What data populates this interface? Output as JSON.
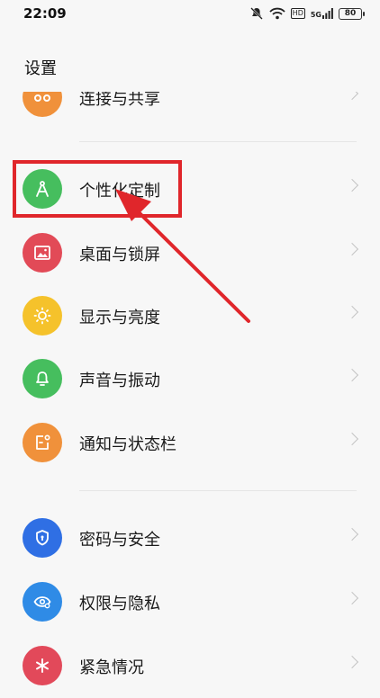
{
  "status_bar": {
    "time": "22:09",
    "hd_label": "HD",
    "network_label": "5G",
    "battery_level": "80"
  },
  "header": {
    "title": "设置"
  },
  "items": [
    {
      "label": "连接与共享",
      "icon": "share-icon",
      "color": "#f0913b"
    },
    {
      "label": "个性化定制",
      "icon": "compass-icon",
      "color": "#46be5e"
    },
    {
      "label": "桌面与锁屏",
      "icon": "image-icon",
      "color": "#e24a57"
    },
    {
      "label": "显示与亮度",
      "icon": "sun-icon",
      "color": "#f5c22b"
    },
    {
      "label": "声音与振动",
      "icon": "bell-icon",
      "color": "#46be5e"
    },
    {
      "label": "通知与状态栏",
      "icon": "notification-icon",
      "color": "#f0913b"
    },
    {
      "label": "密码与安全",
      "icon": "shield-icon",
      "color": "#2f6fe4"
    },
    {
      "label": "权限与隐私",
      "icon": "eye-icon",
      "color": "#2f8be6"
    },
    {
      "label": "紧急情况",
      "icon": "asterisk-icon",
      "color": "#e2495a"
    }
  ],
  "annotation": {
    "color": "#e0262b"
  }
}
